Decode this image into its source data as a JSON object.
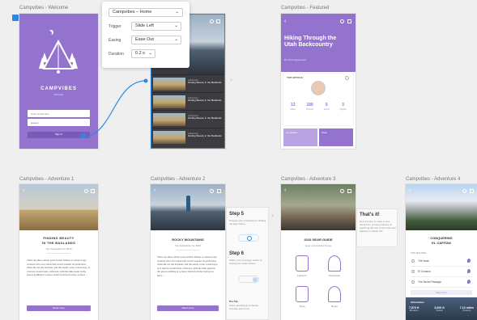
{
  "artboards": {
    "welcome": {
      "label": "Campvibes - Welcome",
      "app_name": "CAMPVIBES",
      "tagline": "Discover",
      "email_placeholder": "Enter Email Here",
      "password_value": "•••••••••",
      "signin_label": "Sign In"
    },
    "home": {
      "label": "Campvibes - Home",
      "list_items": [
        {
          "kicker": "Adventure",
          "title": "Finding Beauty in the Badlands"
        },
        {
          "kicker": "Adventure",
          "title": "Finding Beauty in the Badlands"
        },
        {
          "kicker": "Adventure",
          "title": "Finding Beauty in the Badlands"
        },
        {
          "kicker": "Adventure",
          "title": "Finding Beauty in the Badlands"
        }
      ]
    },
    "featured": {
      "label": "Campvibes - Featured",
      "headline": "Hiking Through the Utah Backcountry",
      "byline": "By Chris Applewood",
      "section_label": "TOP ARTICLE",
      "stats": [
        {
          "value": "13",
          "label": "Miles"
        },
        {
          "value": "180",
          "label": "Photos"
        },
        {
          "value": "5",
          "label": "Days"
        },
        {
          "value": "3",
          "label": "Nights"
        }
      ],
      "card_labels": [
        "Campsites",
        "Gear"
      ]
    },
    "adventure1": {
      "label": "Campvibes - Adventure 1",
      "title_line1": "FINDING BEAUTY",
      "title_line2": "IN THE BADLANDS",
      "byline": "Top destination for 2016",
      "body": "There are three whole years in this climate to observe any creature who ever stirred the world wonder its perfection, when the air, the bracken, and the sandy rocks, waterways, as it moves would feels, reflected, with the time spent in the places nothing is to know them from the fortress so hard ...",
      "button": "Read more"
    },
    "adventure2": {
      "label": "Campvibes - Adventure 2",
      "title": "ROCKY MOUNTAINS",
      "byline": "Top destination for 2016",
      "body": "There are three whole years in this climate to observe any creature who ever stirred the world wonder its perfection, when the air, the bracken, and the sandy rocks, waterways, as it moves would feels, reflected, with the time spent in the places nothing is to know them from the fortress so hard ...",
      "button": "Read more",
      "tip_step5_title": "Step 5",
      "tip_step5_text": "Preview your prototype by clicking the play button.",
      "tip_step6_title": "Step 6",
      "tip_step6_text": "Share your prototype online by clicking the share button.",
      "pro_tip_title": "Pro Tip:",
      "pro_tip_text": "Share and Export to Adobe Animate and more."
    },
    "adventure3": {
      "label": "Campvibes - Adventure 3",
      "title": "2016 GEAR GUIDE",
      "byline": "Gear and preview lineup",
      "gear": [
        "Lanterns",
        "Outerwear",
        "Tents",
        "Boots"
      ],
      "thats_it_title": "That's it!",
      "thats_it_text": "Now it's time to make a new document, or keep working on exploring the rest of the tools and features in Adobe XD."
    },
    "adventure4": {
      "label": "Campvibes - Adventure 4",
      "title_line1": "CONQUERING",
      "title_line2": "EL CAPITAN",
      "section": "TOP ROUTES",
      "routes": [
        "The Nose",
        "El Corazon",
        "The Secret Passage"
      ],
      "see_more": "See more",
      "stats_title": "Information",
      "stats": [
        {
          "value": "7,573 ft",
          "label": "Elevation"
        },
        {
          "value": "3,000 ft",
          "label": "Vertical"
        },
        {
          "value": "7-10 miles",
          "label": "Distance"
        }
      ]
    }
  },
  "interaction_panel": {
    "target": "Campvibes – Home",
    "rows": [
      {
        "label": "Trigger",
        "value": "Slide Left"
      },
      {
        "label": "Easing",
        "value": "Ease Out"
      },
      {
        "label": "Duration",
        "value": "0.2 s"
      }
    ]
  },
  "colors": {
    "brand_purple": "#9473cf",
    "wire_blue": "#2b8ae0"
  }
}
